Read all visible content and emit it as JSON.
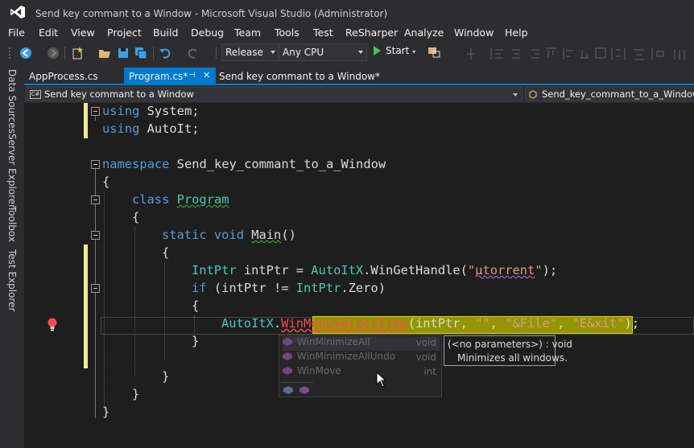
{
  "window": {
    "title": "Send key commant to a Window - Microsoft Visual Studio  (Administrator)"
  },
  "menu": [
    "File",
    "Edit",
    "View",
    "Project",
    "Build",
    "Debug",
    "Team",
    "Tools",
    "Test",
    "ReSharper",
    "Analyze",
    "Window",
    "Help"
  ],
  "toolbar": {
    "config": "Release",
    "platform": "Any CPU",
    "start_label": "Start"
  },
  "side_tabs": [
    "Data Sources",
    "Server Explorer",
    "Toolbox",
    "Test Explorer"
  ],
  "doc_tabs": [
    {
      "label": "AppProcess.cs"
    },
    {
      "label": "Program.cs*",
      "pin": "⊣",
      "close": "✕"
    },
    {
      "label": "Send key commant to a Window*"
    }
  ],
  "nav": {
    "project": "Send key commant to a Window",
    "member": "Send_key_commant_to_a_Window.P",
    "cs": "C#"
  },
  "code": {
    "l1_kw": "using",
    "l1_rest": " System;",
    "l2_kw": "using",
    "l2_rest": " AutoIt;",
    "l4_kw": "namespace",
    "l4_rest": " Send_key_commant_to_a_Window",
    "brace_open": "{",
    "brace_close": "}",
    "l6_kw": "class",
    "l6_type": "Program",
    "l8_kw1": "static",
    "l8_kw2": "void",
    "l8_name": "Main",
    "l8_rest": "()",
    "l10_type": "IntPtr",
    "l10_a": " intPtr = ",
    "l10_cls": "AutoItX",
    "l10_b": ".WinGetHandle(",
    "l10_q1": "\"",
    "l10_str": "µtorrent",
    "l10_q2": "\"",
    "l10_c": ");",
    "l11_kw": "if",
    "l11_a": " (intPtr != ",
    "l11_type": "IntPtr",
    "l11_b": ".Zero)",
    "l13_cls": "AutoItX",
    "l13_dot": ".",
    "l13_err": "WinMenuSelectItem",
    "l13_a": "(intPtr, ",
    "l13_s1": "\"\"",
    "l13_c1": ", ",
    "l13_s2": "\"&File\"",
    "l13_c2": ", ",
    "l13_s3": "\"E&xit\"",
    "l13_end": ");"
  },
  "completion": [
    {
      "name": "WinMinimizeAll",
      "type": "void"
    },
    {
      "name": "WinMinimizeAllUndo",
      "type": "void"
    },
    {
      "name": "WinMove",
      "type": "int"
    }
  ],
  "tooltip": {
    "line1": "(<no parameters>) : void",
    "line2": "Minimizes all windows."
  },
  "colors": {
    "accent": "#007acc",
    "keyword": "#569cd6",
    "type": "#4ec9b0",
    "string": "#d69d85",
    "highlight": "#9b9b04"
  }
}
